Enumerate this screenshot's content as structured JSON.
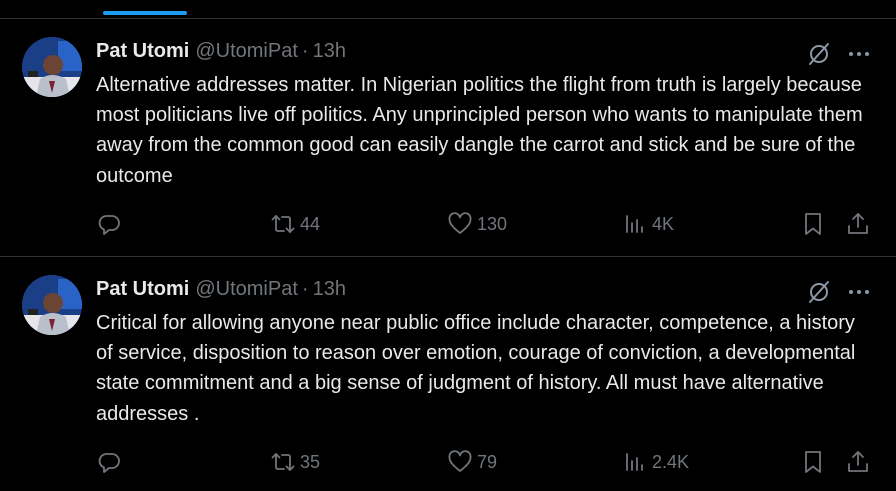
{
  "colors": {
    "accent": "#1d9bf0",
    "text": "#e7e9ea",
    "muted": "#71767b",
    "divider": "#2f3336"
  },
  "tweets": [
    {
      "name": "Pat Utomi",
      "handle": "@UtomiPat",
      "separator": "·",
      "time": "13h",
      "text": "Alternative addresses matter. In Nigerian politics the flight from truth is largely because most politicians live off politics. Any unprincipled person who wants to manipulate them away from the common good can easily dangle the carrot and stick and be sure of the outcome",
      "reposts": "44",
      "likes": "130",
      "views": "4K"
    },
    {
      "name": "Pat Utomi",
      "handle": "@UtomiPat",
      "separator": "·",
      "time": "13h",
      "text": "Critical for allowing anyone near public office include character, competence, a history of service, disposition to reason over emotion, courage of conviction, a developmental state commitment and a big sense of judgment of history. All must have alternative addresses .",
      "reposts": "35",
      "likes": "79",
      "views": "2.4K"
    }
  ]
}
